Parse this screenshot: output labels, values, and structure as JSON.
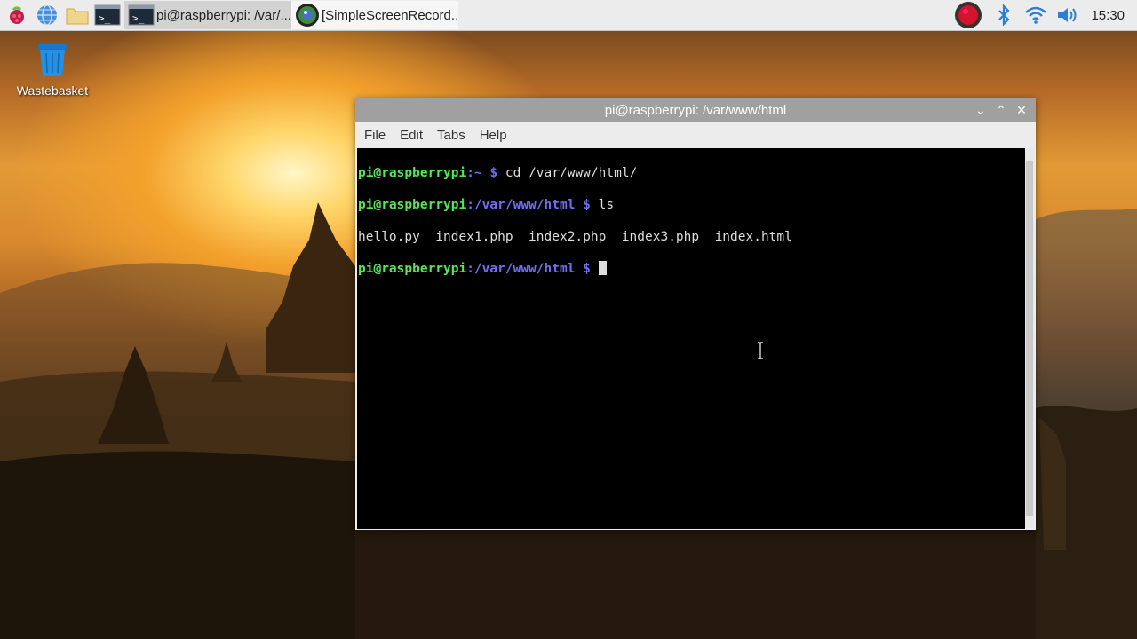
{
  "taskbar": {
    "tasks": [
      {
        "label": "pi@raspberrypi: /var/..."
      },
      {
        "label": "[SimpleScreenRecord..."
      }
    ],
    "clock": "15:30"
  },
  "desktop": {
    "wastebasket_label": "Wastebasket"
  },
  "terminal": {
    "title": "pi@raspberrypi: /var/www/html",
    "menu": [
      "File",
      "Edit",
      "Tabs",
      "Help"
    ],
    "lines": [
      {
        "user": "pi@raspberrypi",
        "path": ":~ $",
        "cmd": " cd /var/www/html/"
      },
      {
        "user": "pi@raspberrypi",
        "path": ":/var/www/html $",
        "cmd": " ls"
      },
      {
        "output": "hello.py  index1.php  index2.php  index3.php  index.html"
      },
      {
        "user": "pi@raspberrypi",
        "path": ":/var/www/html $",
        "cmd": " "
      }
    ]
  },
  "colors": {
    "prompt_user": "#55e855",
    "prompt_path": "#6f6ff2",
    "titlebar": "#a0a0a0"
  }
}
